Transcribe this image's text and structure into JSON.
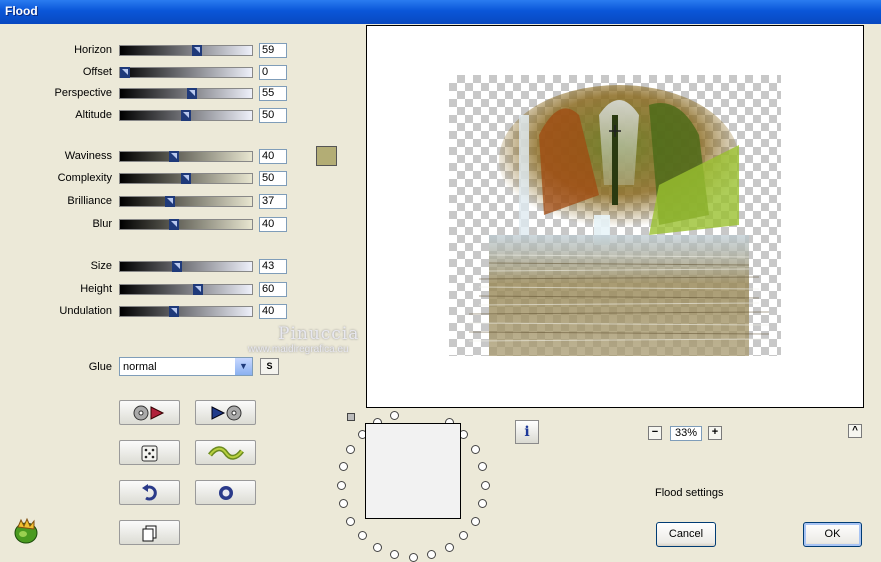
{
  "window": {
    "title": "Flood"
  },
  "sliders_group1": [
    {
      "label": "Horizon",
      "value": "59",
      "level": 0.59
    },
    {
      "label": "Offset",
      "value": "0",
      "level": 0.0
    },
    {
      "label": "Perspective",
      "value": "55",
      "level": 0.55
    },
    {
      "label": "Altitude",
      "value": "50",
      "level": 0.5
    }
  ],
  "sliders_group2": [
    {
      "label": "Waviness",
      "value": "40",
      "level": 0.4
    },
    {
      "label": "Complexity",
      "value": "50",
      "level": 0.5
    },
    {
      "label": "Brilliance",
      "value": "37",
      "level": 0.37
    },
    {
      "label": "Blur",
      "value": "40",
      "level": 0.4
    }
  ],
  "sliders_group3": [
    {
      "label": "Size",
      "value": "43",
      "level": 0.43
    },
    {
      "label": "Height",
      "value": "60",
      "level": 0.6
    },
    {
      "label": "Undulation",
      "value": "40",
      "level": 0.4
    }
  ],
  "color_swatch": "#b3ad75",
  "glue": {
    "label": "Glue",
    "selected": "normal",
    "s_button": "S"
  },
  "watermark": {
    "line1": "Pinuccia",
    "line2": "www.maidiregrafica.eu"
  },
  "zoom": {
    "value": "33%",
    "minus": "−",
    "plus": "+"
  },
  "scroll_up": "^",
  "info_button": "i",
  "status_text": "Flood settings",
  "buttons": {
    "cancel": "Cancel",
    "ok": "OK"
  },
  "icons": [
    "load-preset-icon",
    "save-preset-icon",
    "randomize-dice-icon",
    "wave-icon",
    "undo-icon",
    "reset-icon",
    "copy-icon",
    "app-logo-icon"
  ]
}
